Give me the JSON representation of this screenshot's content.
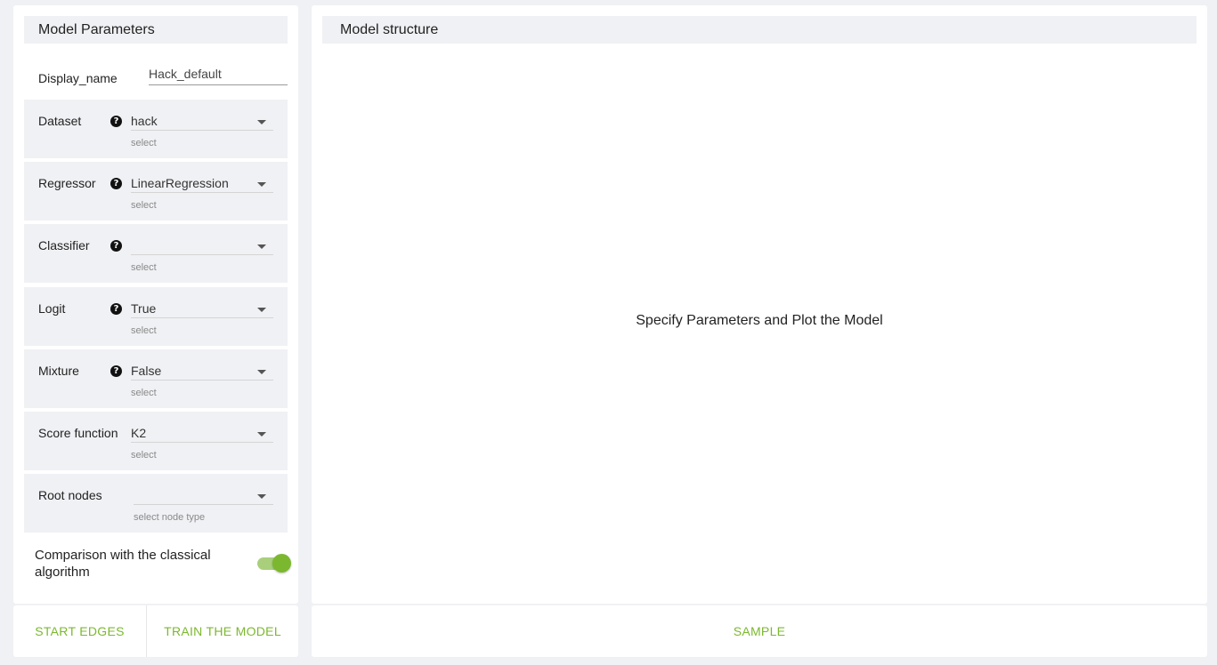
{
  "left_panel": {
    "title": "Model Parameters",
    "display_name": {
      "label": "Display_name",
      "value": "Hack_default"
    },
    "params": [
      {
        "label": "Dataset",
        "value": "hack",
        "hint": "select",
        "help": true
      },
      {
        "label": "Regressor",
        "value": "LinearRegression",
        "hint": "select",
        "help": true
      },
      {
        "label": "Classifier",
        "value": "",
        "hint": "select",
        "help": true
      },
      {
        "label": "Logit",
        "value": "True",
        "hint": "select",
        "help": true
      },
      {
        "label": "Mixture",
        "value": "False",
        "hint": "select",
        "help": true
      },
      {
        "label": "Score function",
        "value": "K2",
        "hint": "select",
        "help": false
      },
      {
        "label": "Root nodes",
        "value": "",
        "hint": "select node type",
        "help": false
      }
    ],
    "help_glyph": "?",
    "toggle": {
      "label": "Comparison with the classical algorithm",
      "on": true
    },
    "actions": {
      "start_edges": "START EDGES",
      "train_model": "TRAIN THE MODEL"
    }
  },
  "right_panel": {
    "title": "Model structure",
    "placeholder": "Specify Parameters and Plot the Model",
    "actions": {
      "sample": "SAMPLE"
    }
  },
  "colors": {
    "accent": "#7cb82f",
    "panel_bg": "#f0f1f4",
    "toggle_track": "#a9cf7c"
  }
}
